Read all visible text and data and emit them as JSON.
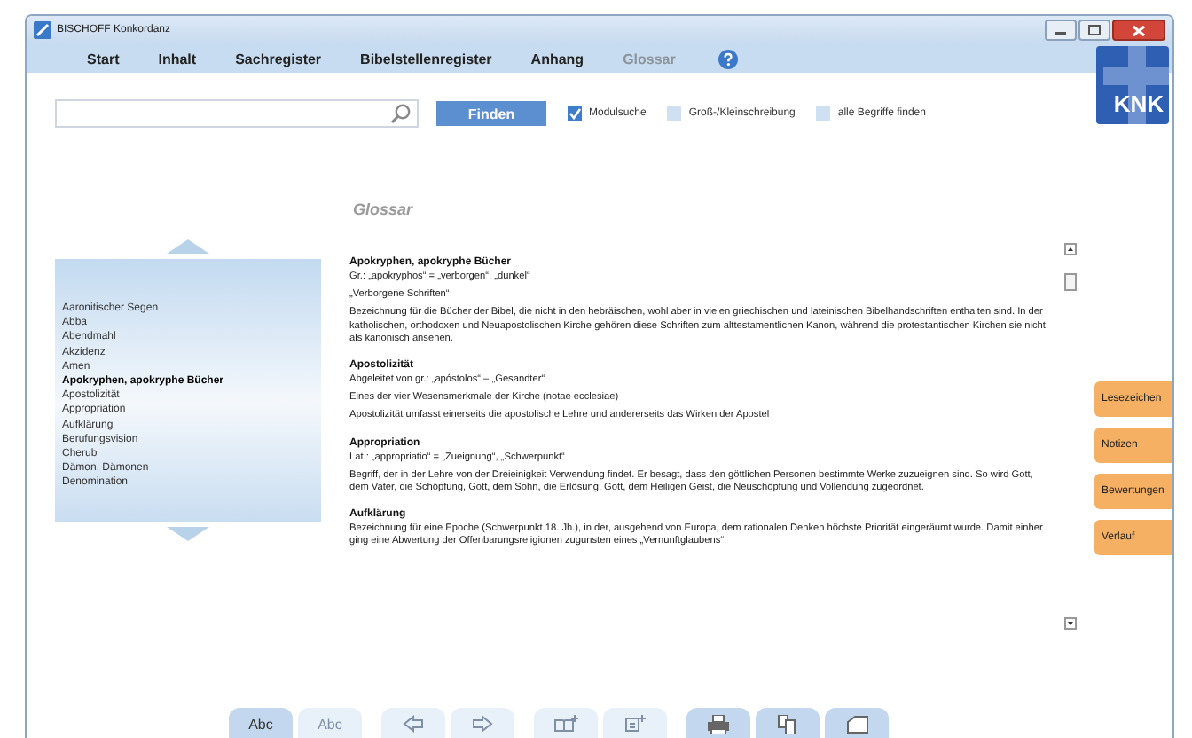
{
  "window": {
    "title": "BISCHOFF Konkordanz"
  },
  "nav": [
    {
      "label": "Start",
      "selected": false
    },
    {
      "label": "Inhalt",
      "selected": false
    },
    {
      "label": "Sachregister",
      "selected": false
    },
    {
      "label": "Bibelstellenregister",
      "selected": false
    },
    {
      "label": "Anhang",
      "selected": false
    },
    {
      "label": "Glossar",
      "selected": true
    }
  ],
  "logo": "KNK",
  "search": {
    "button": "Finden"
  },
  "options": [
    {
      "label": "Modulsuche",
      "checked": true
    },
    {
      "label": "Groß-/Kleinschreibung",
      "checked": false
    },
    {
      "label": "alle Begriffe finden",
      "checked": false
    }
  ],
  "index": [
    {
      "label": "Aaronitischer Segen",
      "selected": false
    },
    {
      "label": "Abba",
      "selected": false
    },
    {
      "label": "Abendmahl",
      "selected": false
    },
    {
      "label": "Akzidenz",
      "selected": false
    },
    {
      "label": "Amen",
      "selected": false
    },
    {
      "label": "Apokryphen, apokryphe Bücher",
      "selected": true
    },
    {
      "label": "Apostolizität",
      "selected": false
    },
    {
      "label": "Appropriation",
      "selected": false
    },
    {
      "label": "Aufklärung",
      "selected": false
    },
    {
      "label": "Berufungsvision",
      "selected": false
    },
    {
      "label": "Cherub",
      "selected": false
    },
    {
      "label": "Dämon, Dämonen",
      "selected": false
    },
    {
      "label": "Denomination",
      "selected": false
    }
  ],
  "glossary": {
    "title": "Glossar",
    "entries": [
      {
        "term": "Apokryphen, apokryphe Bücher",
        "lines": [
          "Gr.: „apokryphos“ = „verborgen“, „dunkel“",
          "„Verborgene Schriften“",
          "Bezeichnung für die Bücher der Bibel, die nicht in den hebräischen, wohl aber in vielen griechischen und lateinischen Bibelhandschriften enthalten sind. In der katholischen, orthodoxen und Neuapostolischen Kirche gehören diese Schriften zum alttestamentlichen Kanon, während die protestantischen Kirchen sie nicht als kanonisch ansehen."
        ]
      },
      {
        "term": "Apostolizität",
        "lines": [
          "Abgeleitet von gr.: „apóstolos“ – „Gesandter“",
          "Eines der vier Wesensmerkmale der Kirche (notae ecclesiae)",
          "Apostolizität umfasst einerseits die apostolische Lehre und andererseits das Wirken der Apostel"
        ]
      },
      {
        "term": "Appropriation",
        "lines": [
          "Lat.: „appropriatio“ = „Zueignung“, „Schwerpunkt“",
          "Begriff, der in der Lehre von der Dreieinigkeit Verwendung findet. Er besagt, dass den göttlichen Personen bestimmte Werke zuzueignen sind. So wird Gott, dem Vater, die Schöpfung, Gott, dem Sohn, die Erlösung, Gott, dem Heiligen Geist, die Neuschöpfung und Vollendung zugeordnet."
        ]
      },
      {
        "term": "Aufklärung",
        "lines": [
          "Bezeichnung für eine Epoche (Schwerpunkt 18. Jh.), in der, ausgehend von Europa, dem rationalen Denken höchste Priorität eingeräumt wurde. Damit einher ging eine Abwertung der Offenbarungsreligionen zugunsten eines „Vernunftglaubens“."
        ]
      }
    ]
  },
  "side_tabs": [
    "Lesezeichen",
    "Notizen",
    "Bewertungen",
    "Verlauf"
  ],
  "toolbar": [
    {
      "kind": "text",
      "label": "Abc",
      "selected": true
    },
    {
      "kind": "text",
      "label": "Abc",
      "selected": false
    },
    {
      "kind": "back",
      "disabled": true
    },
    {
      "kind": "forward",
      "disabled": true
    },
    {
      "kind": "book-add",
      "disabled": true
    },
    {
      "kind": "note-add",
      "disabled": true
    },
    {
      "kind": "print",
      "disabled": false
    },
    {
      "kind": "copy",
      "disabled": false
    },
    {
      "kind": "folder",
      "disabled": false
    }
  ]
}
